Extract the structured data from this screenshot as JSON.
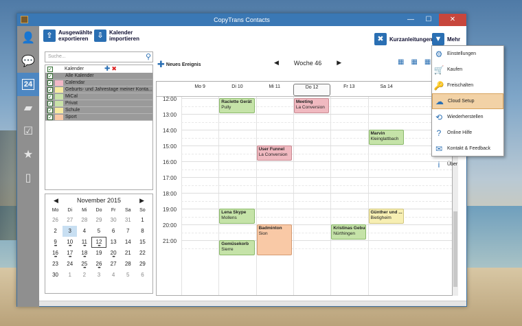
{
  "window": {
    "title": "CopyTrans Contacts"
  },
  "toolbar": {
    "export_label": "Ausgewählte exportieren",
    "import_label": "Kalender importieren",
    "guides_label": "Kurzanleitungen",
    "more_label": "Mehr"
  },
  "search": {
    "placeholder": "Suche..."
  },
  "calendars": {
    "header": "Kalender",
    "items": [
      {
        "label": "Alle Kalender",
        "color": "#9a9a9a"
      },
      {
        "label": "Calendar",
        "color": "#f2b8c6"
      },
      {
        "label": "Geburts- und Jahrestage meiner Konta...",
        "color": "#f7eba0"
      },
      {
        "label": "MiCal",
        "color": "#c9e2a8"
      },
      {
        "label": "Privat",
        "color": "#c9e2a8"
      },
      {
        "label": "Schule",
        "color": "#f7eba0"
      },
      {
        "label": "Sport",
        "color": "#f9c9a6"
      }
    ]
  },
  "mini_calendar": {
    "month_label": "November 2015",
    "weekdays": [
      "Mo",
      "Di",
      "Mi",
      "Do",
      "Fr",
      "Sa",
      "So"
    ],
    "days": [
      {
        "d": "26",
        "o": true
      },
      {
        "d": "27",
        "o": true
      },
      {
        "d": "28",
        "o": true
      },
      {
        "d": "29",
        "o": true
      },
      {
        "d": "30",
        "o": true
      },
      {
        "d": "31",
        "o": true
      },
      {
        "d": "1"
      },
      {
        "d": "2"
      },
      {
        "d": "3",
        "sel": true
      },
      {
        "d": "4"
      },
      {
        "d": "5"
      },
      {
        "d": "6"
      },
      {
        "d": "7"
      },
      {
        "d": "8"
      },
      {
        "d": "9"
      },
      {
        "d": "10"
      },
      {
        "d": "11"
      },
      {
        "d": "12",
        "today": true
      },
      {
        "d": "13"
      },
      {
        "d": "14"
      },
      {
        "d": "15"
      },
      {
        "d": "16"
      },
      {
        "d": "17"
      },
      {
        "d": "18"
      },
      {
        "d": "19"
      },
      {
        "d": "20"
      },
      {
        "d": "21"
      },
      {
        "d": "22"
      },
      {
        "d": "23"
      },
      {
        "d": "24"
      },
      {
        "d": "25"
      },
      {
        "d": "26"
      },
      {
        "d": "27"
      },
      {
        "d": "28"
      },
      {
        "d": "29"
      },
      {
        "d": "30"
      },
      {
        "d": "1",
        "o": true
      },
      {
        "d": "2",
        "o": true
      },
      {
        "d": "3",
        "o": true
      },
      {
        "d": "4",
        "o": true
      },
      {
        "d": "5",
        "o": true
      },
      {
        "d": "6",
        "o": true
      }
    ]
  },
  "week": {
    "new_event_label": "Neues Ereignis",
    "label": "Woche 46",
    "days": [
      "Mo 9",
      "Di 10",
      "Mi 11",
      "Do 12",
      "Fr 13",
      "Sa 14"
    ],
    "times": [
      "12:00",
      "13:00",
      "14:00",
      "15:00",
      "16:00",
      "17:00",
      "18:00",
      "19:00",
      "20:00",
      "21:00"
    ],
    "events": [
      {
        "title": "Raclette Gerät",
        "loc": "Pully",
        "day": 1,
        "start": 12.0,
        "end": 13.0,
        "style": "green"
      },
      {
        "title": "Meeting",
        "loc": "La Conversion",
        "day": 3,
        "start": 12.0,
        "end": 13.0,
        "style": "pink"
      },
      {
        "title": "Marvin",
        "loc": "Kleinglattbach",
        "day": 5,
        "start": 14.0,
        "end": 15.0,
        "style": "green"
      },
      {
        "title": "User Funnel",
        "loc": "La Conversion",
        "day": 2,
        "start": 15.0,
        "end": 16.0,
        "style": "pink"
      },
      {
        "title": "Lena Skype",
        "loc": "Mollens",
        "day": 1,
        "start": 19.0,
        "end": 20.0,
        "style": "green"
      },
      {
        "title": "Günther und ...",
        "loc": "Bietigheim",
        "day": 5,
        "start": 19.0,
        "end": 20.0,
        "style": "yellow"
      },
      {
        "title": "Badminton",
        "loc": "Sion",
        "day": 2,
        "start": 20.0,
        "end": 22.0,
        "style": "orange"
      },
      {
        "title": "Kristinas Gebur...",
        "loc": "Nürthingen",
        "day": 4,
        "start": 20.0,
        "end": 21.0,
        "style": "green"
      },
      {
        "title": "Gemüsekorb",
        "loc": "Sierre",
        "day": 1,
        "start": 21.0,
        "end": 22.0,
        "style": "green"
      }
    ]
  },
  "menu": {
    "items": [
      {
        "label": "Einstellungen",
        "icon": "gear-icon",
        "glyph": "⚙"
      },
      {
        "label": "Kaufen",
        "icon": "cart-icon",
        "glyph": "🛒"
      },
      {
        "label": "Freischalten",
        "icon": "key-icon",
        "glyph": "🔑"
      },
      {
        "label": "Cloud Setup",
        "icon": "cloud-icon",
        "glyph": "☁",
        "hover": true
      },
      {
        "label": "Wiederherstellen",
        "icon": "restore-icon",
        "glyph": "⟲"
      },
      {
        "label": "Online Hilfe",
        "icon": "question-icon",
        "glyph": "?"
      },
      {
        "label": "Kontakt & Feedback",
        "icon": "mail-icon",
        "glyph": "✉"
      },
      {
        "label": "Über",
        "icon": "info-icon",
        "glyph": "i"
      }
    ]
  }
}
